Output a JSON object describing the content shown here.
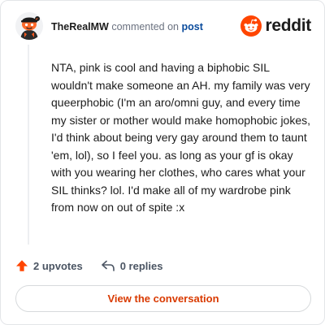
{
  "author": {
    "username": "TheRealMW",
    "avatar_icon": "snoo-avatar-icon"
  },
  "context": {
    "action_text": "commented on",
    "post_link_text": "post"
  },
  "brand": {
    "name": "reddit",
    "icon": "reddit-logo-icon",
    "color": "#ff4500"
  },
  "comment": {
    "text": "NTA, pink is cool and having a biphobic SIL wouldn't make someone an AH. my family was very queerphobic (I'm an aro/omni guy, and every time my sister or mother would make homophobic jokes, I'd think about being very gay around them to taunt 'em, lol), so I feel you. as long as your gf is okay with you wearing her clothes, who cares what your SIL thinks? lol. I'd make all of my wardrobe pink from now on out of spite :x"
  },
  "stats": {
    "upvotes_label": "2 upvotes",
    "upvote_icon": "upvote-arrow-icon",
    "upvote_color": "#ff4500",
    "replies_label": "0 replies",
    "reply_icon": "reply-arrow-icon"
  },
  "cta": {
    "label": "View the conversation",
    "color": "#d93a00"
  }
}
